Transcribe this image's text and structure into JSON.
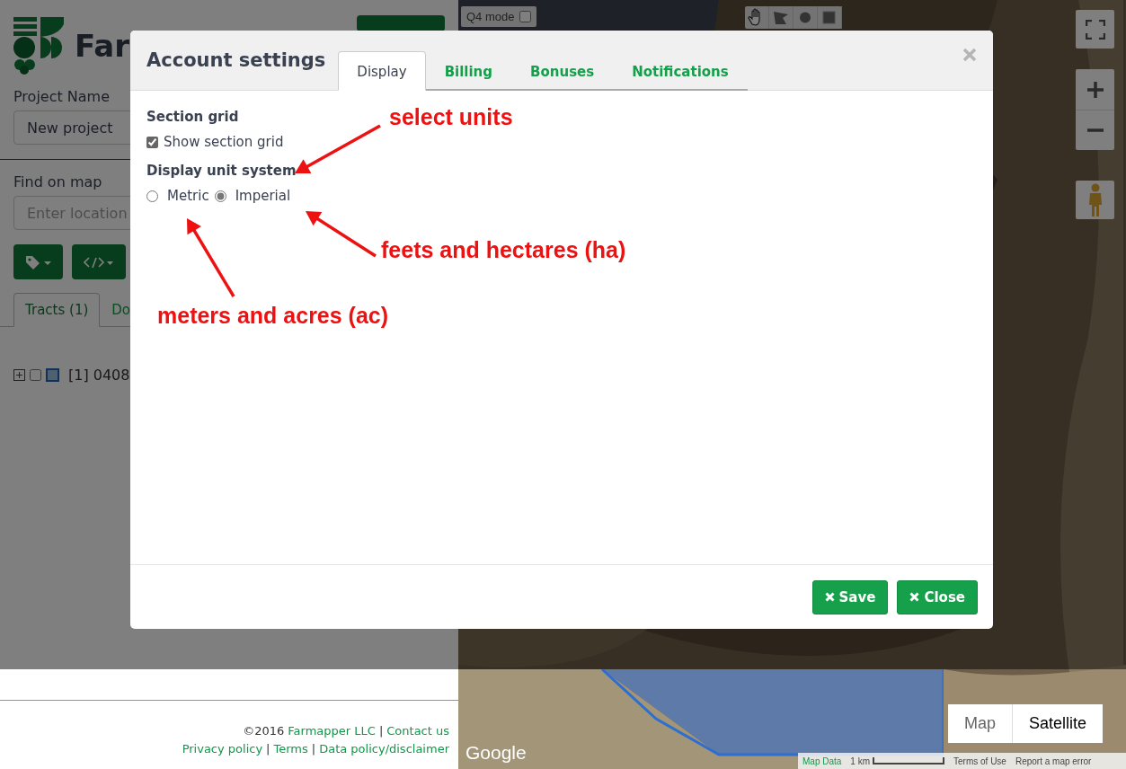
{
  "sidebar": {
    "logo_text": "Far",
    "project_name_label": "Project Name",
    "project_name_value": "New project",
    "find_label": "Find on map",
    "location_placeholder": "Enter location",
    "tabs": [
      {
        "label": "Tracts (1)",
        "selected": true
      },
      {
        "label": "Do",
        "selected": false
      }
    ],
    "tract": {
      "label": "[1] 0408",
      "checked": false
    }
  },
  "footer": {
    "lines": [
      [
        {
          "kind": "text",
          "text": "©2016"
        },
        {
          "kind": "link",
          "text": "Farmapper LLC"
        },
        {
          "kind": "separator",
          "text": "|"
        },
        {
          "kind": "link",
          "text": "Contact us"
        }
      ],
      [
        {
          "kind": "link",
          "text": "Privacy policy"
        },
        {
          "kind": "separator",
          "text": "|"
        },
        {
          "kind": "link",
          "text": "Terms"
        },
        {
          "kind": "separator",
          "text": "|"
        },
        {
          "kind": "link",
          "text": "Data policy/disclaimer"
        }
      ]
    ]
  },
  "map": {
    "q4_mode": {
      "label": "Q4 mode",
      "checked": false
    },
    "logo": "Google",
    "map_data": "Map Data",
    "scale": "1 km",
    "terms": "Terms of Use",
    "report": "Report a map error",
    "map_types": [
      {
        "label": "Map",
        "selected": false
      },
      {
        "label": "Satellite",
        "selected": true
      }
    ]
  },
  "dialog": {
    "title": "Account settings",
    "tabs": [
      {
        "label": "Display",
        "selected": true
      },
      {
        "label": "Billing",
        "selected": false
      },
      {
        "label": "Bonuses",
        "selected": false
      },
      {
        "label": "Notifications",
        "selected": false
      }
    ],
    "section_grid_heading": "Section grid",
    "show_grid": {
      "label": "Show section grid",
      "checked": true
    },
    "unit_heading": "Display unit system",
    "unit_options": [
      {
        "label": "Metric",
        "selected": false
      },
      {
        "label": "Imperial",
        "selected": true
      }
    ],
    "buttons": [
      "Save",
      "Close"
    ]
  },
  "annotations": [
    {
      "text": "select units"
    },
    {
      "text": "feets and hectares (ha)"
    },
    {
      "text": "meters and acres (ac)"
    }
  ]
}
